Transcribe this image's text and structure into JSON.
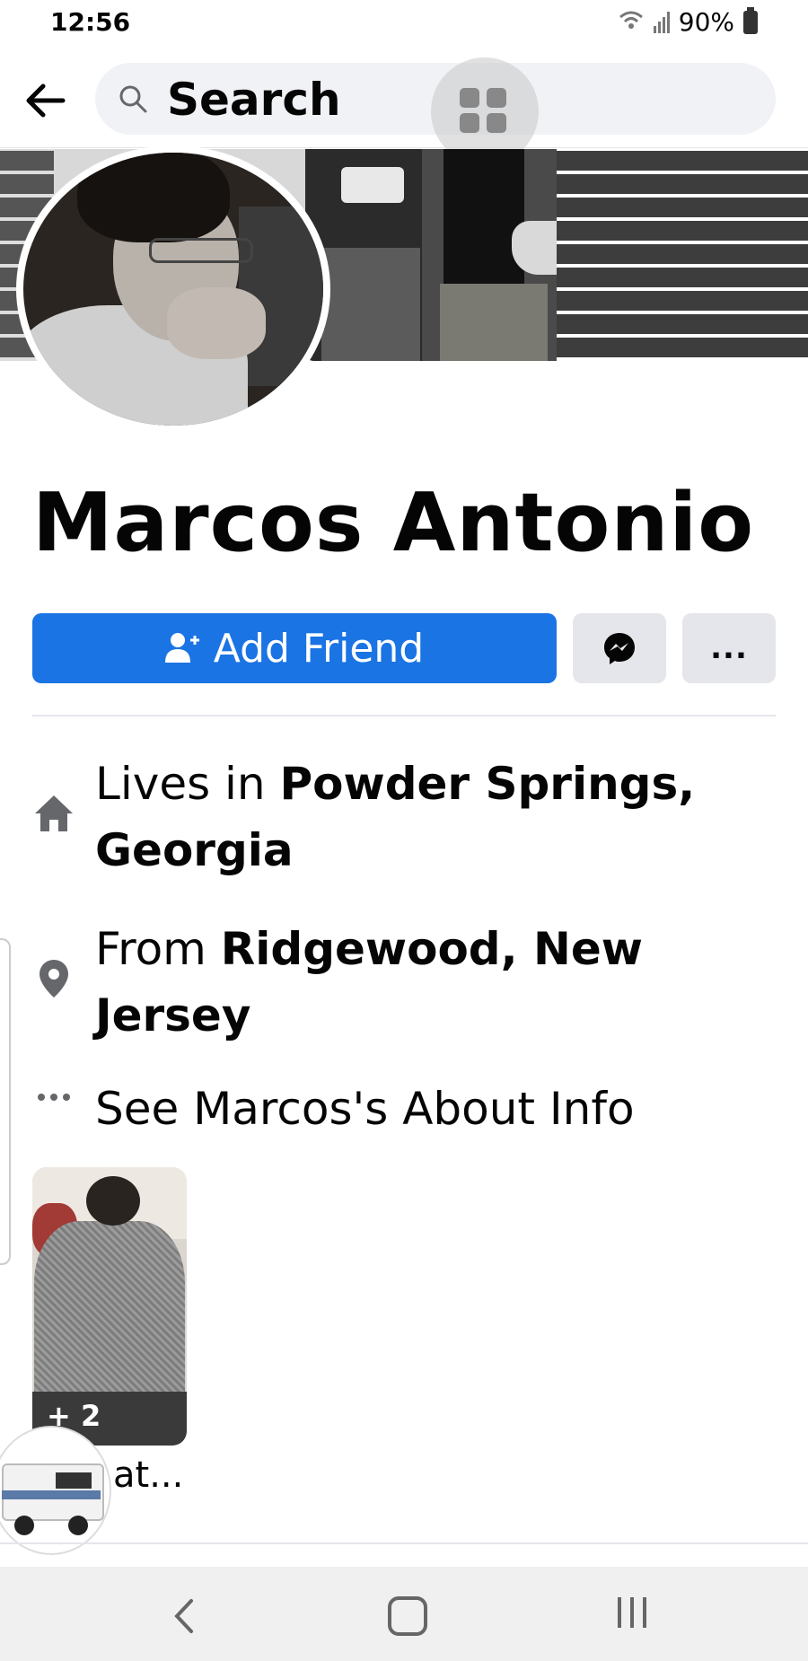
{
  "status_bar": {
    "time": "12:56",
    "battery": "90%"
  },
  "top_bar": {
    "search_label": "Search",
    "icons": [
      "back-arrow-icon",
      "search-icon",
      "grid-icon"
    ]
  },
  "profile": {
    "name": "Marcos Antonio",
    "add_friend_label": "Add Friend",
    "more_label": "..."
  },
  "details": {
    "lives_prefix": "Lives in ",
    "lives_place": "Powder Springs, Georgia",
    "from_prefix": "From ",
    "from_place": "Ridgewood, New Jersey",
    "about_link": "See Marcos's About Info"
  },
  "featured": {
    "count_badge": "+ 2",
    "caption": "at..."
  },
  "colors": {
    "primary": "#1b74e4",
    "button_gray": "#e4e6eb",
    "text": "#050505",
    "icon_gray": "#65676b"
  }
}
